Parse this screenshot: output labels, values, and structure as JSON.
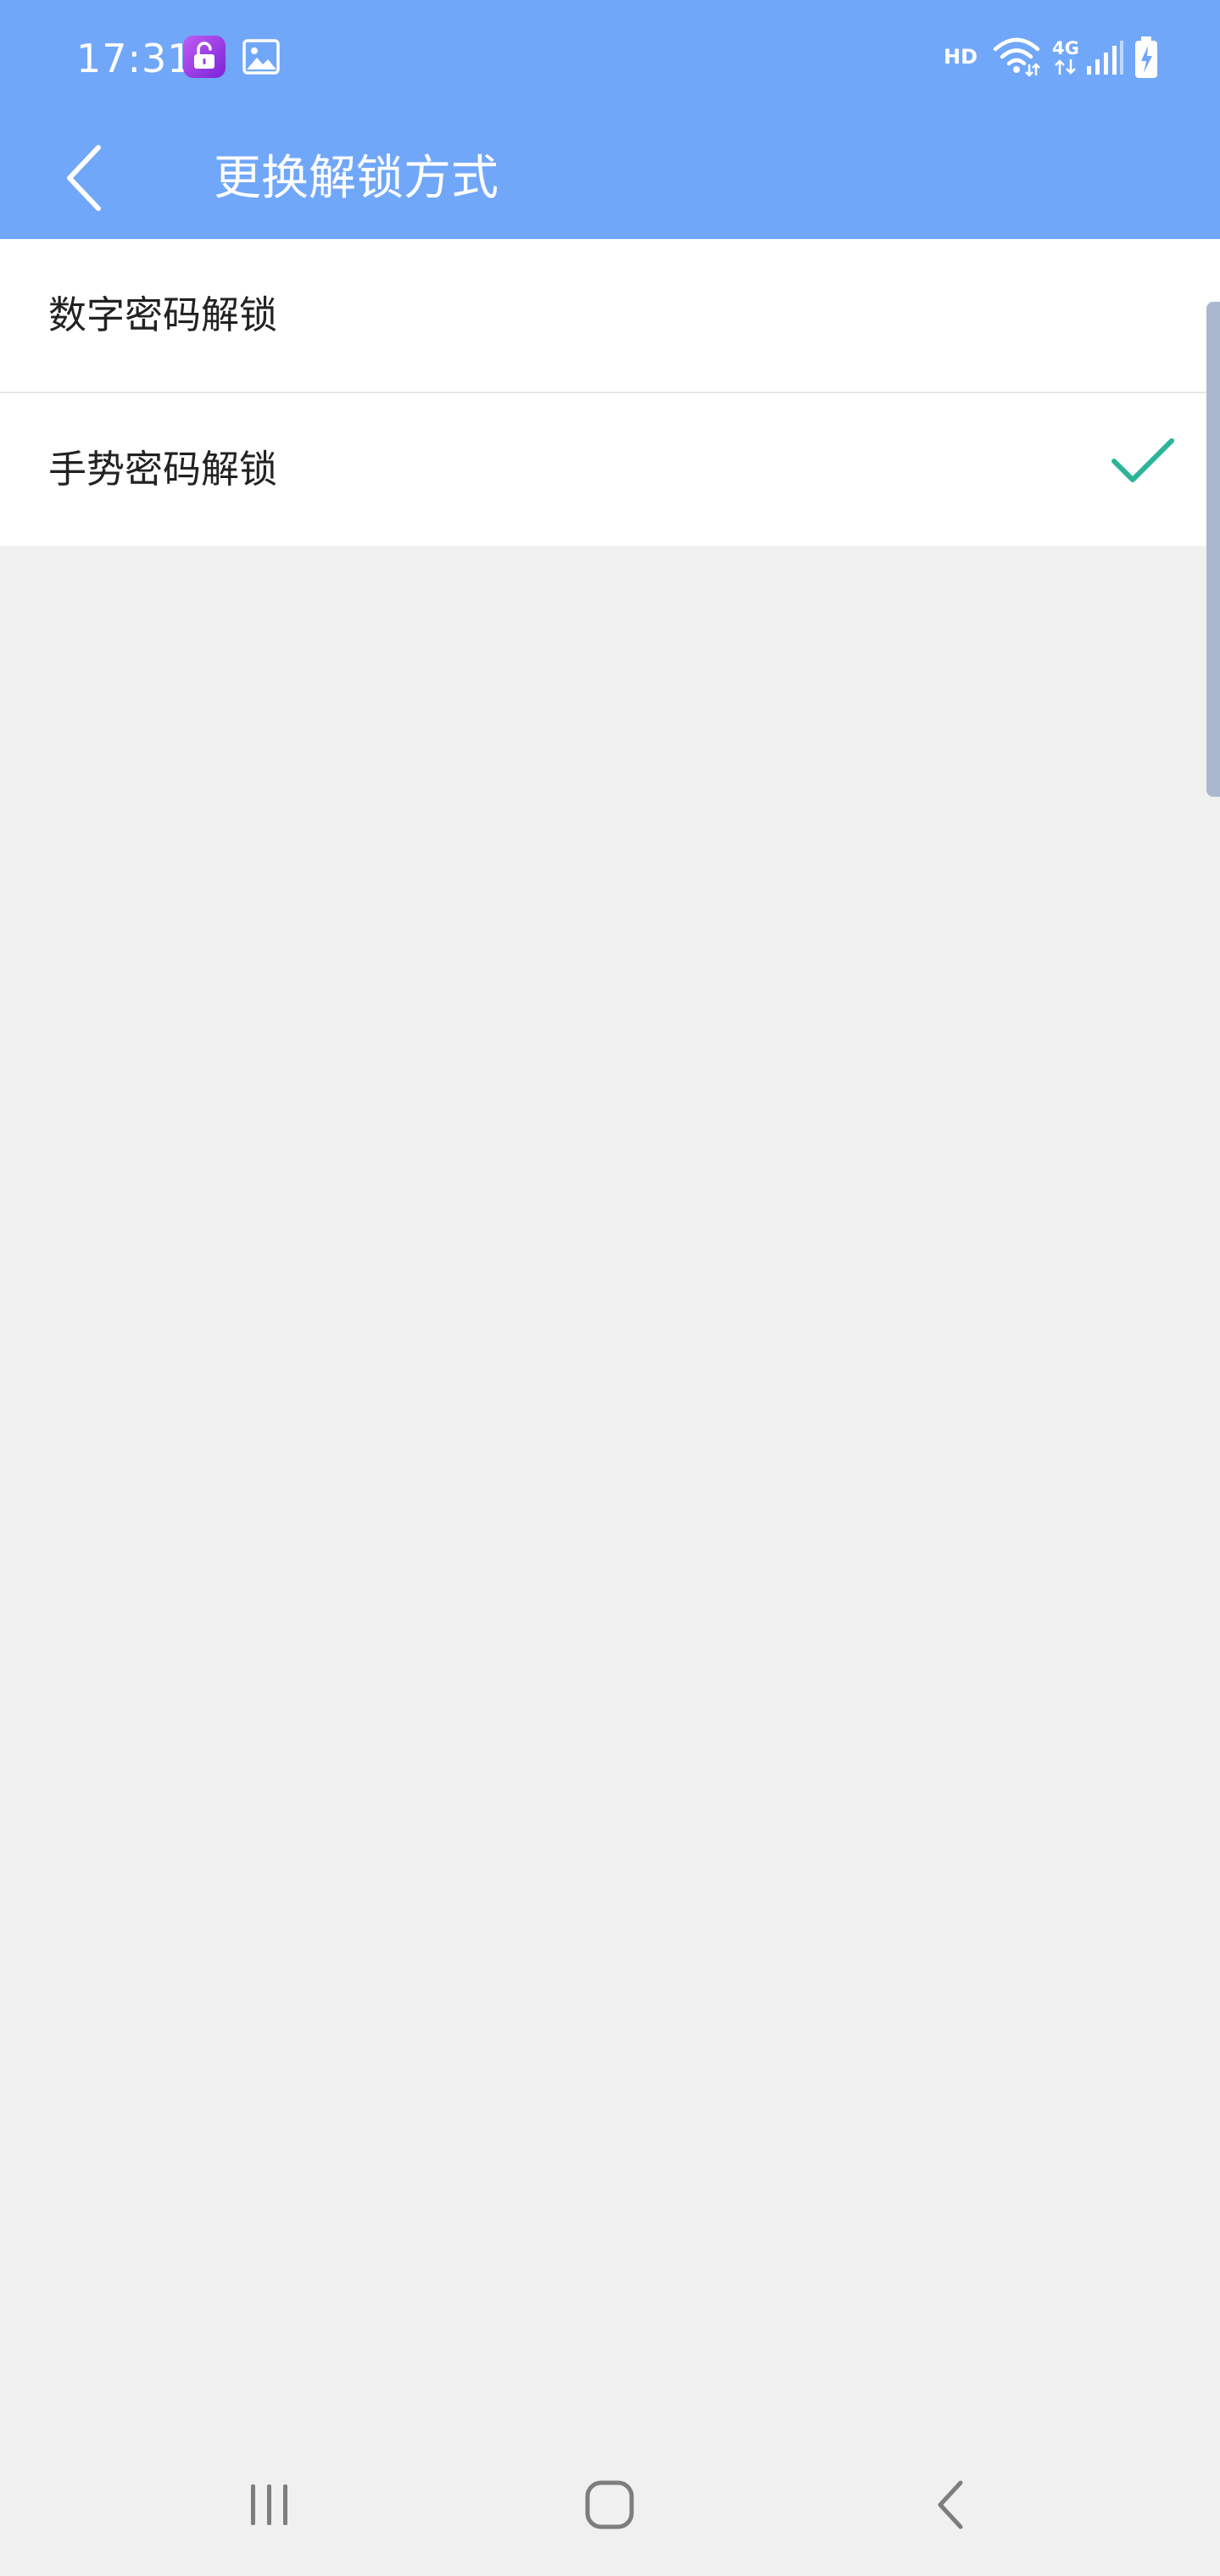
{
  "status_bar": {
    "time": "17:31",
    "hd": "HD",
    "network": "4G",
    "icons": [
      "app-lock-icon",
      "gallery-icon",
      "wifi-icon",
      "data-updown-icon",
      "signal-icon",
      "battery-charging-icon"
    ]
  },
  "toolbar": {
    "back_icon": "chevron-left-icon",
    "title": "更换解锁方式"
  },
  "options": [
    {
      "label": "数字密码解锁",
      "selected": false
    },
    {
      "label": "手势密码解锁",
      "selected": true,
      "icon": "check-icon"
    }
  ],
  "navigation": {
    "icons": [
      "recent-apps-icon",
      "home-icon",
      "back-icon"
    ]
  },
  "colors": {
    "header": "#71a7f9",
    "background": "#f0f0f0",
    "surface": "#ffffff",
    "divider": "#e6e6e6",
    "check": "#2bb497",
    "text": "#222222",
    "nav_icon": "#7d7d7d",
    "app_icon": "#9b3fe3"
  }
}
